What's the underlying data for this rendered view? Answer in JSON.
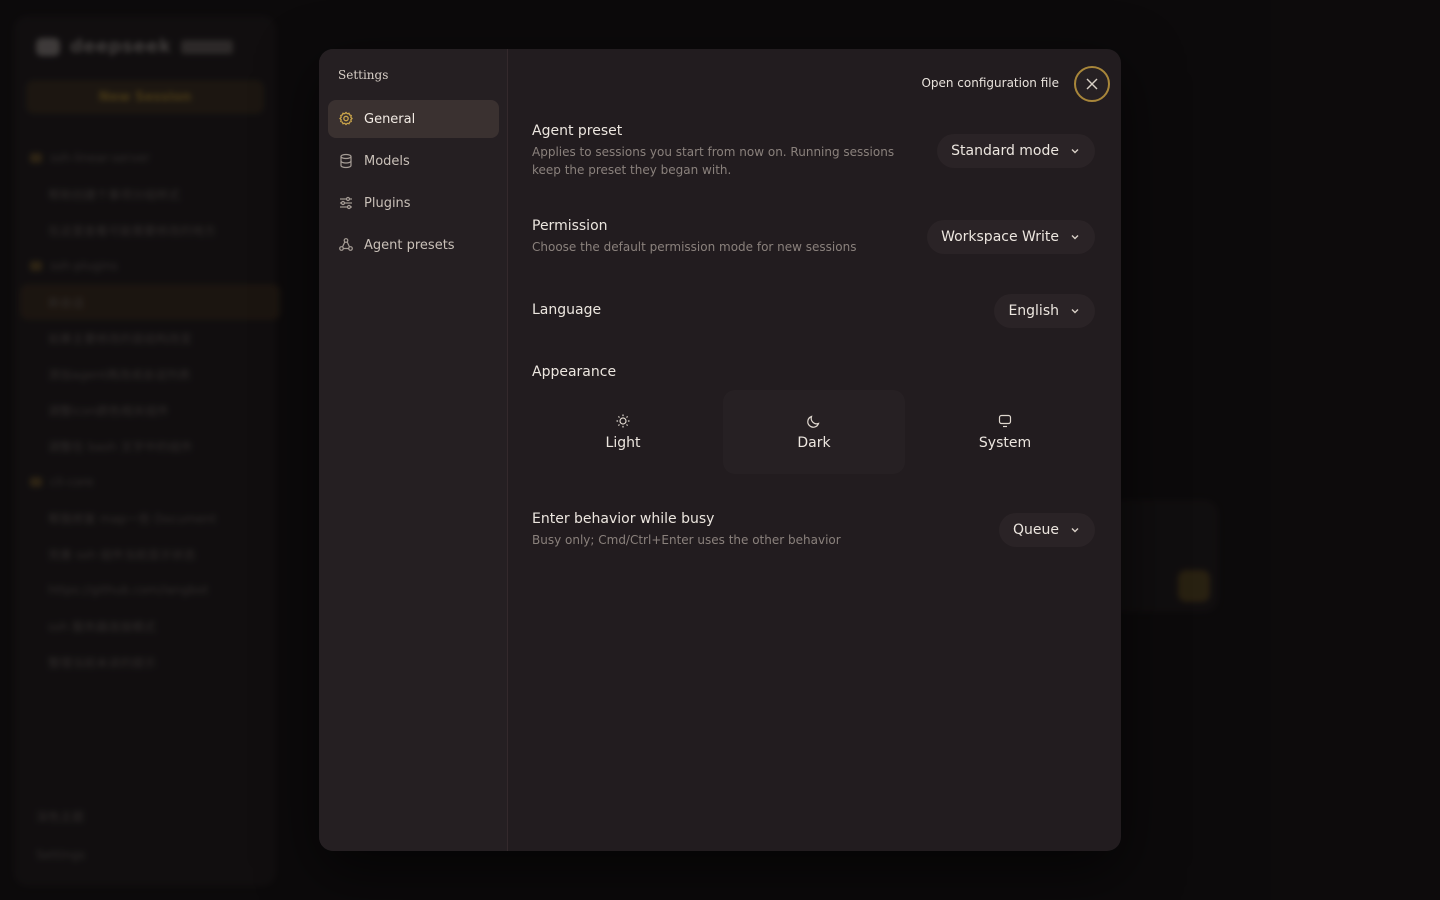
{
  "background": {
    "logo_text": "deepseek",
    "new_session": "New Session",
    "sidebar_rows": [
      {
        "kind": "folder",
        "text": "ssh-linear-server"
      },
      {
        "kind": "item",
        "text": "帮助创建个事项分组样式"
      },
      {
        "kind": "item",
        "text": "在这里查看可能需要修改的地方"
      },
      {
        "kind": "folder",
        "text": "ssh-plugins"
      },
      {
        "kind": "active",
        "text": "新会话"
      },
      {
        "kind": "item",
        "text": "如果主要修改的是结构改变"
      },
      {
        "kind": "item",
        "text": "添加agent再改成会话列表"
      },
      {
        "kind": "item",
        "text": "调整icon颜色相关组件"
      },
      {
        "kind": "item",
        "text": "调整在 bash 文字中的组件"
      },
      {
        "kind": "folder",
        "text": "cli-core"
      },
      {
        "kind": "item",
        "text": "帮我修复 map一些 Document"
      },
      {
        "kind": "item",
        "text": "完善 ssh 组件当前显示状态"
      },
      {
        "kind": "item",
        "text": "https://github.com/langbot"
      },
      {
        "kind": "item",
        "text": "ssh 服务器连接模式"
      },
      {
        "kind": "item",
        "text": "整理当前未读的提示"
      }
    ],
    "footer_items": [
      "深色主题",
      "Settings"
    ]
  },
  "modal": {
    "nav_title": "Settings",
    "nav_items": [
      {
        "label": "General",
        "icon": "gear-icon",
        "active": true
      },
      {
        "label": "Models",
        "icon": "database-icon",
        "active": false
      },
      {
        "label": "Plugins",
        "icon": "sliders-icon",
        "active": false
      },
      {
        "label": "Agent presets",
        "icon": "agents-icon",
        "active": false
      }
    ],
    "open_config": "Open configuration file",
    "agent_preset": {
      "label": "Agent preset",
      "desc_line1": "Applies to sessions you start from now on. Running sessions",
      "desc_line2": "keep the preset they began with.",
      "value": "Standard mode"
    },
    "permission": {
      "label": "Permission",
      "desc": "Choose the default permission mode for new sessions",
      "value": "Workspace Write"
    },
    "language": {
      "label": "Language",
      "value": "English"
    },
    "appearance": {
      "label": "Appearance",
      "options": [
        {
          "label": "Light",
          "icon": "sun-icon",
          "active": false
        },
        {
          "label": "Dark",
          "icon": "moon-icon",
          "active": true
        },
        {
          "label": "System",
          "icon": "monitor-icon",
          "active": false
        }
      ]
    },
    "enter_behavior": {
      "label": "Enter behavior while busy",
      "desc": "Busy only; Cmd/Ctrl+Enter uses the other behavior",
      "value": "Queue"
    }
  },
  "colors": {
    "accent": "#a8863a",
    "modal_bg": "#221c1f",
    "nav_active_bg": "#3a3130"
  }
}
